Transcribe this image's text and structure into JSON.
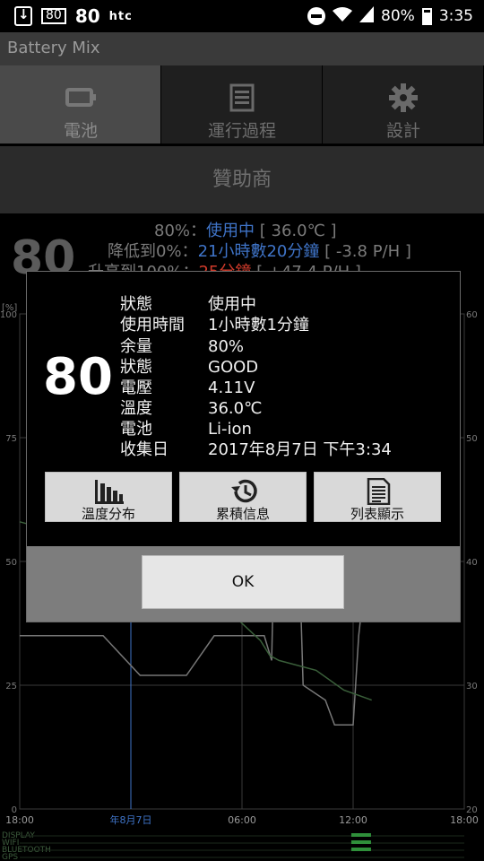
{
  "status_bar": {
    "battery_badge": "80",
    "battery_level_bold": "80",
    "carrier": "htc",
    "battery_percent": "80%",
    "time": "3:35",
    "icons": [
      "download-icon",
      "battery-badge-icon",
      "do-not-disturb-icon",
      "wifi-icon",
      "signal-icon",
      "battery-icon"
    ]
  },
  "app": {
    "title": "Battery Mix"
  },
  "tabs": [
    {
      "label": "電池",
      "icon": "battery-icon",
      "active": true
    },
    {
      "label": "運行過程",
      "icon": "list-icon",
      "active": false
    },
    {
      "label": "設計",
      "icon": "gear-icon",
      "active": false
    }
  ],
  "sponsor": {
    "label": "贊助商"
  },
  "battery_summary": {
    "level": "80",
    "line1": {
      "prefix": "80%：",
      "status": "使用中",
      "temp": "[ 36.0℃ ]"
    },
    "line2": {
      "prefix": "降低到0%：",
      "time": "21小時數20分鐘",
      "rate": "[ -3.8 P/H ]"
    },
    "line3": {
      "prefix": "升高到100%：",
      "time": "25分鐘",
      "rate": "[ +47.4 P/H ]"
    }
  },
  "chart_data": {
    "type": "line",
    "y_left_ticks": [
      "100",
      "75",
      "50",
      "25",
      "0"
    ],
    "y_left_unit": "[%]",
    "y_right_ticks": [
      "60",
      "50",
      "40",
      "30",
      "20"
    ],
    "x_ticks": [
      "18:00",
      "06:00",
      "12:00",
      "18:00"
    ],
    "date_label": "年8月7日",
    "x_range_hours": [
      0,
      24
    ],
    "ylim": [
      0,
      100
    ],
    "series": [
      {
        "values": [
          [
            0,
            35
          ],
          [
            4.5,
            35
          ],
          [
            6.5,
            27
          ],
          [
            9,
            27
          ],
          [
            10.5,
            35
          ],
          [
            13.2,
            35
          ],
          [
            13.6,
            30
          ],
          [
            14,
            98
          ],
          [
            14.7,
            100
          ],
          [
            15.3,
            25
          ],
          [
            16.5,
            22
          ],
          [
            17,
            17
          ],
          [
            18,
            17
          ],
          [
            18.3,
            35
          ],
          [
            18.8,
            52
          ],
          [
            19,
            54
          ]
        ]
      },
      {
        "values": [
          [
            0,
            58
          ],
          [
            2,
            56
          ],
          [
            5,
            51
          ],
          [
            7,
            48
          ],
          [
            9,
            44
          ],
          [
            11,
            41
          ],
          [
            13,
            34
          ],
          [
            13.5,
            31
          ],
          [
            14,
            30
          ],
          [
            16,
            28
          ],
          [
            17.5,
            24
          ],
          [
            19,
            22
          ]
        ]
      }
    ],
    "lanes": [
      "DISPLAY",
      "WIFI",
      "BLUETOOTH",
      "GPS"
    ],
    "colors": {
      "level": "#777777",
      "temperature": "#3a5f3a",
      "grid": "#3a3a3a",
      "marker": "#3f74c8"
    }
  },
  "dialog": {
    "level": "80",
    "rows": [
      {
        "key": "狀態",
        "value": "使用中"
      },
      {
        "key": "使用時間",
        "value": "1小時數1分鐘"
      },
      {
        "key": "余量",
        "value": "80%"
      },
      {
        "key": "狀態",
        "value": "GOOD"
      },
      {
        "key": "電壓",
        "value": "4.11V"
      },
      {
        "key": "溫度",
        "value": "36.0℃"
      },
      {
        "key": "電池",
        "value": "Li-ion"
      },
      {
        "key": "收集日",
        "value": "2017年8月7日  下午3:34"
      }
    ],
    "buttons": [
      {
        "label": "溫度分布",
        "icon": "bar-chart-icon"
      },
      {
        "label": "累積信息",
        "icon": "history-icon"
      },
      {
        "label": "列表顯示",
        "icon": "document-icon"
      }
    ],
    "ok_label": "OK"
  }
}
